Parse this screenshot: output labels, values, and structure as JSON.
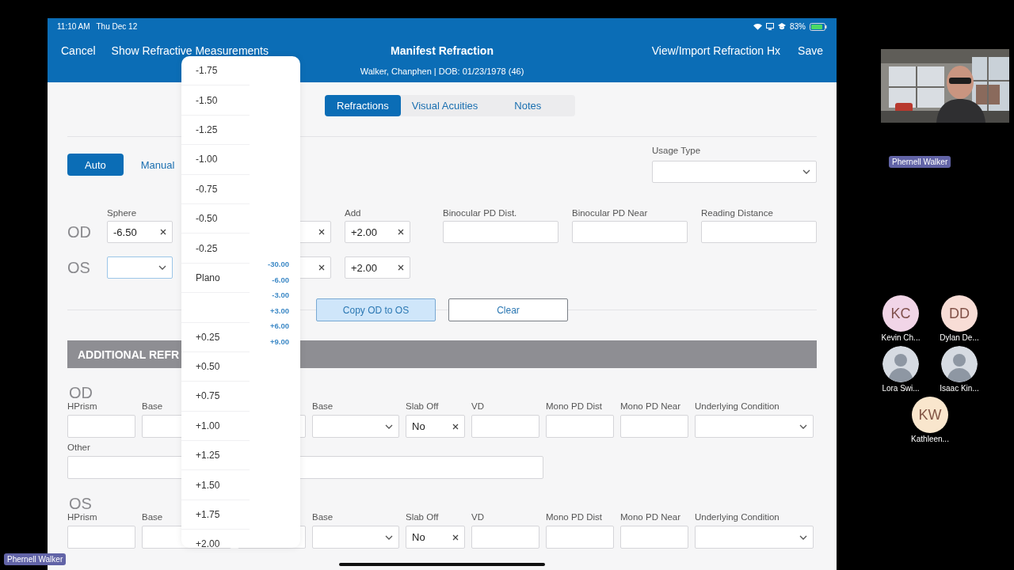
{
  "status_bar": {
    "time": "11:10 AM",
    "date": "Thu Dec 12",
    "battery": "83%"
  },
  "nav": {
    "left": [
      "Cancel",
      "Show Refractive Measurements"
    ],
    "title": "Manifest Refraction",
    "subtitle": "Walker, Chanphen | DOB: 01/23/1978 (46)",
    "right": [
      "View/Import Refraction Hx",
      "Save"
    ]
  },
  "tabs": [
    {
      "label": "Refractions",
      "selected": true
    },
    {
      "label": "Visual Acuities",
      "selected": false
    },
    {
      "label": "Notes",
      "selected": false
    }
  ],
  "mode": [
    {
      "label": "Auto",
      "selected": true
    },
    {
      "label": "Manual",
      "selected": false
    }
  ],
  "usage_type": {
    "label": "Usage Type"
  },
  "refraction": {
    "sphere_label": "Sphere",
    "add_label": "Add",
    "rows": [
      {
        "eye": "OD",
        "sphere": {
          "kind": "clear",
          "value": "-6.50",
          "focused": false
        },
        "column_3": {
          "kind": "clear"
        },
        "add": {
          "kind": "clear",
          "value": "+2.00"
        },
        "binocular_labels": [
          "Binocular PD Dist.",
          "Binocular PD Near",
          "Reading Distance"
        ]
      },
      {
        "eye": "OS",
        "sphere": {
          "kind": "select",
          "focused": true
        },
        "column_3": {
          "kind": "clear"
        },
        "add": {
          "kind": "clear",
          "value": "+2.00"
        }
      }
    ]
  },
  "buttons": [
    {
      "label": "Copy OD to OS",
      "highlighted": true
    },
    {
      "label": "Clear",
      "highlighted": false
    }
  ],
  "additional": {
    "title": "ADDITIONAL REFR",
    "eyes": [
      {
        "eye": "OD",
        "fields": [
          {
            "label": "HPrism",
            "kind": "text"
          },
          {
            "label": "Base",
            "kind": "text"
          },
          {
            "kind": "text"
          },
          {
            "label": "Base",
            "kind": "select"
          },
          {
            "label": "Slab Off",
            "kind": "clear",
            "value": "No"
          },
          {
            "label": "VD",
            "kind": "text"
          },
          {
            "label": "Mono PD Dist",
            "kind": "text"
          },
          {
            "label": "Mono PD Near",
            "kind": "text"
          },
          {
            "label": "Underlying Condition",
            "kind": "select"
          }
        ],
        "other": {
          "label": "Other"
        }
      },
      {
        "eye": "OS",
        "fields": [
          {
            "label": "HPrism",
            "kind": "text"
          },
          {
            "label": "Base",
            "kind": "text"
          },
          {
            "kind": "text"
          },
          {
            "label": "Base",
            "kind": "select"
          },
          {
            "label": "Slab Off",
            "kind": "clear",
            "value": "No"
          },
          {
            "label": "VD",
            "kind": "text"
          },
          {
            "label": "Mono PD Dist",
            "kind": "text"
          },
          {
            "label": "Mono PD Near",
            "kind": "text"
          },
          {
            "label": "Underlying Condition",
            "kind": "select"
          }
        ]
      }
    ]
  },
  "picker": {
    "items": [
      {
        "kind": "value",
        "label": "-1.75"
      },
      {
        "kind": "value",
        "label": "-1.50"
      },
      {
        "kind": "value",
        "label": "-1.25"
      },
      {
        "kind": "value",
        "label": "-1.00"
      },
      {
        "kind": "value",
        "label": "-0.75"
      },
      {
        "kind": "value",
        "label": "-0.50"
      },
      {
        "kind": "value",
        "label": "-0.25"
      },
      {
        "kind": "value",
        "label": "Plano"
      },
      {
        "kind": "blank"
      },
      {
        "kind": "value",
        "label": "+0.25"
      },
      {
        "kind": "value",
        "label": "+0.50"
      },
      {
        "kind": "value",
        "label": "+0.75"
      },
      {
        "kind": "value",
        "label": "+1.00"
      },
      {
        "kind": "value",
        "label": "+1.25"
      },
      {
        "kind": "value",
        "label": "+1.50"
      },
      {
        "kind": "value",
        "label": "+1.75"
      },
      {
        "kind": "value",
        "label": "+2.00"
      }
    ],
    "index": [
      "-30.00",
      "-6.00",
      "-3.00",
      "+3.00",
      "+6.00",
      "+9.00"
    ]
  },
  "call": {
    "self_view": {
      "kind": "picture",
      "name": "Phernell Walker"
    },
    "participants": [
      {
        "kind": "initials",
        "initials": "KC",
        "name": "Kevin Ch...",
        "color": "#f1d5e7"
      },
      {
        "kind": "initials",
        "initials": "DD",
        "name": "Dylan De...",
        "color": "#f8ddd6"
      },
      {
        "name": "Lora Swi..."
      },
      {
        "name": "Isaac Kin..."
      },
      {
        "kind": "initials",
        "initials": "KW",
        "name": "Kathleen...",
        "color": "#f9e6cd"
      }
    ],
    "presenter": "Phernell Walker"
  }
}
